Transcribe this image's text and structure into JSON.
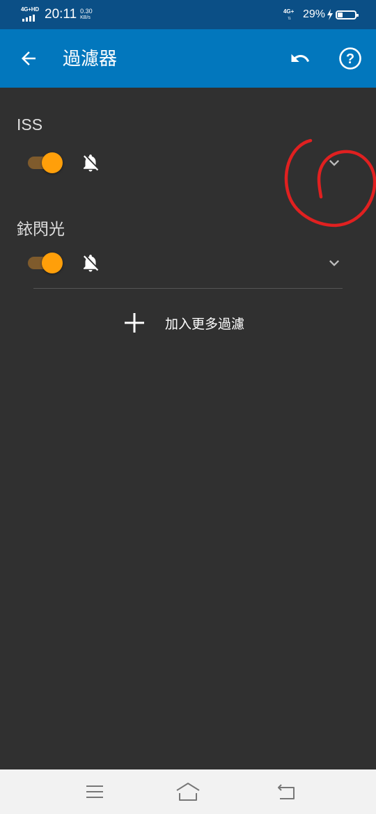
{
  "status_bar": {
    "network_left": "4G+HD",
    "time": "20:11",
    "speed_value": "0.30",
    "speed_unit": "KB/s",
    "network_right": "4G+",
    "battery_percent": "29%",
    "battery_level": 0.29,
    "charging": true
  },
  "app_bar": {
    "title": "過濾器",
    "back_icon": "arrow-back-icon",
    "undo_icon": "undo-icon",
    "help_icon": "help-circle-icon",
    "background": "#0277bd"
  },
  "filters": [
    {
      "name": "ISS",
      "enabled": true,
      "notifications": "off"
    },
    {
      "name": "銥閃光",
      "enabled": true,
      "notifications": "off"
    }
  ],
  "add_filter": {
    "label": "加入更多過濾",
    "icon": "plus-icon"
  },
  "colors": {
    "background": "#303030",
    "accent": "#ff9f0a",
    "status_bar": "#0b4f86",
    "annotation": "#e02020"
  },
  "nav_bar": {
    "icons": [
      "menu-icon",
      "home-icon",
      "back-icon"
    ]
  }
}
